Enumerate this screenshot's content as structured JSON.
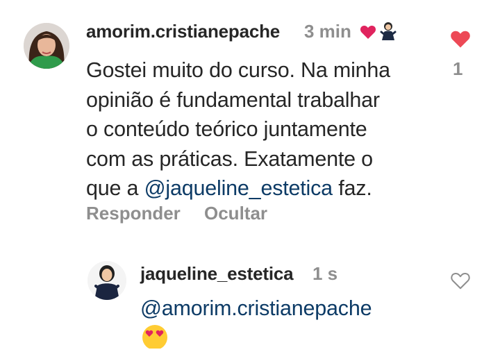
{
  "comment": {
    "username": "amorim.cristianepache",
    "time": "3 min",
    "text_line1": "Gostei muito do curso. Na minha",
    "text_line2": "opinião é fundamental trabalhar",
    "text_line3": "o conteúdo teórico juntamente",
    "text_line4": "com as práticas. Exatamente o",
    "text_line5_prefix": "que a ",
    "mention": "@jaqueline_estetica",
    "text_line5_suffix": " faz.",
    "like_count": "1",
    "liked": true,
    "badges": [
      "heart-icon",
      "person-emoji-icon"
    ],
    "actions": {
      "reply": "Responder",
      "hide": "Ocultar"
    }
  },
  "reply": {
    "username": "jaqueline_estetica",
    "time": "1 s",
    "mention": "@amorim.cristianepache",
    "emoji": "heart-eyes-emoji-icon",
    "liked": false
  },
  "colors": {
    "text": "#262626",
    "secondary": "#8e8e8e",
    "mention": "#0d3b66",
    "like_red": "#ed4956"
  }
}
